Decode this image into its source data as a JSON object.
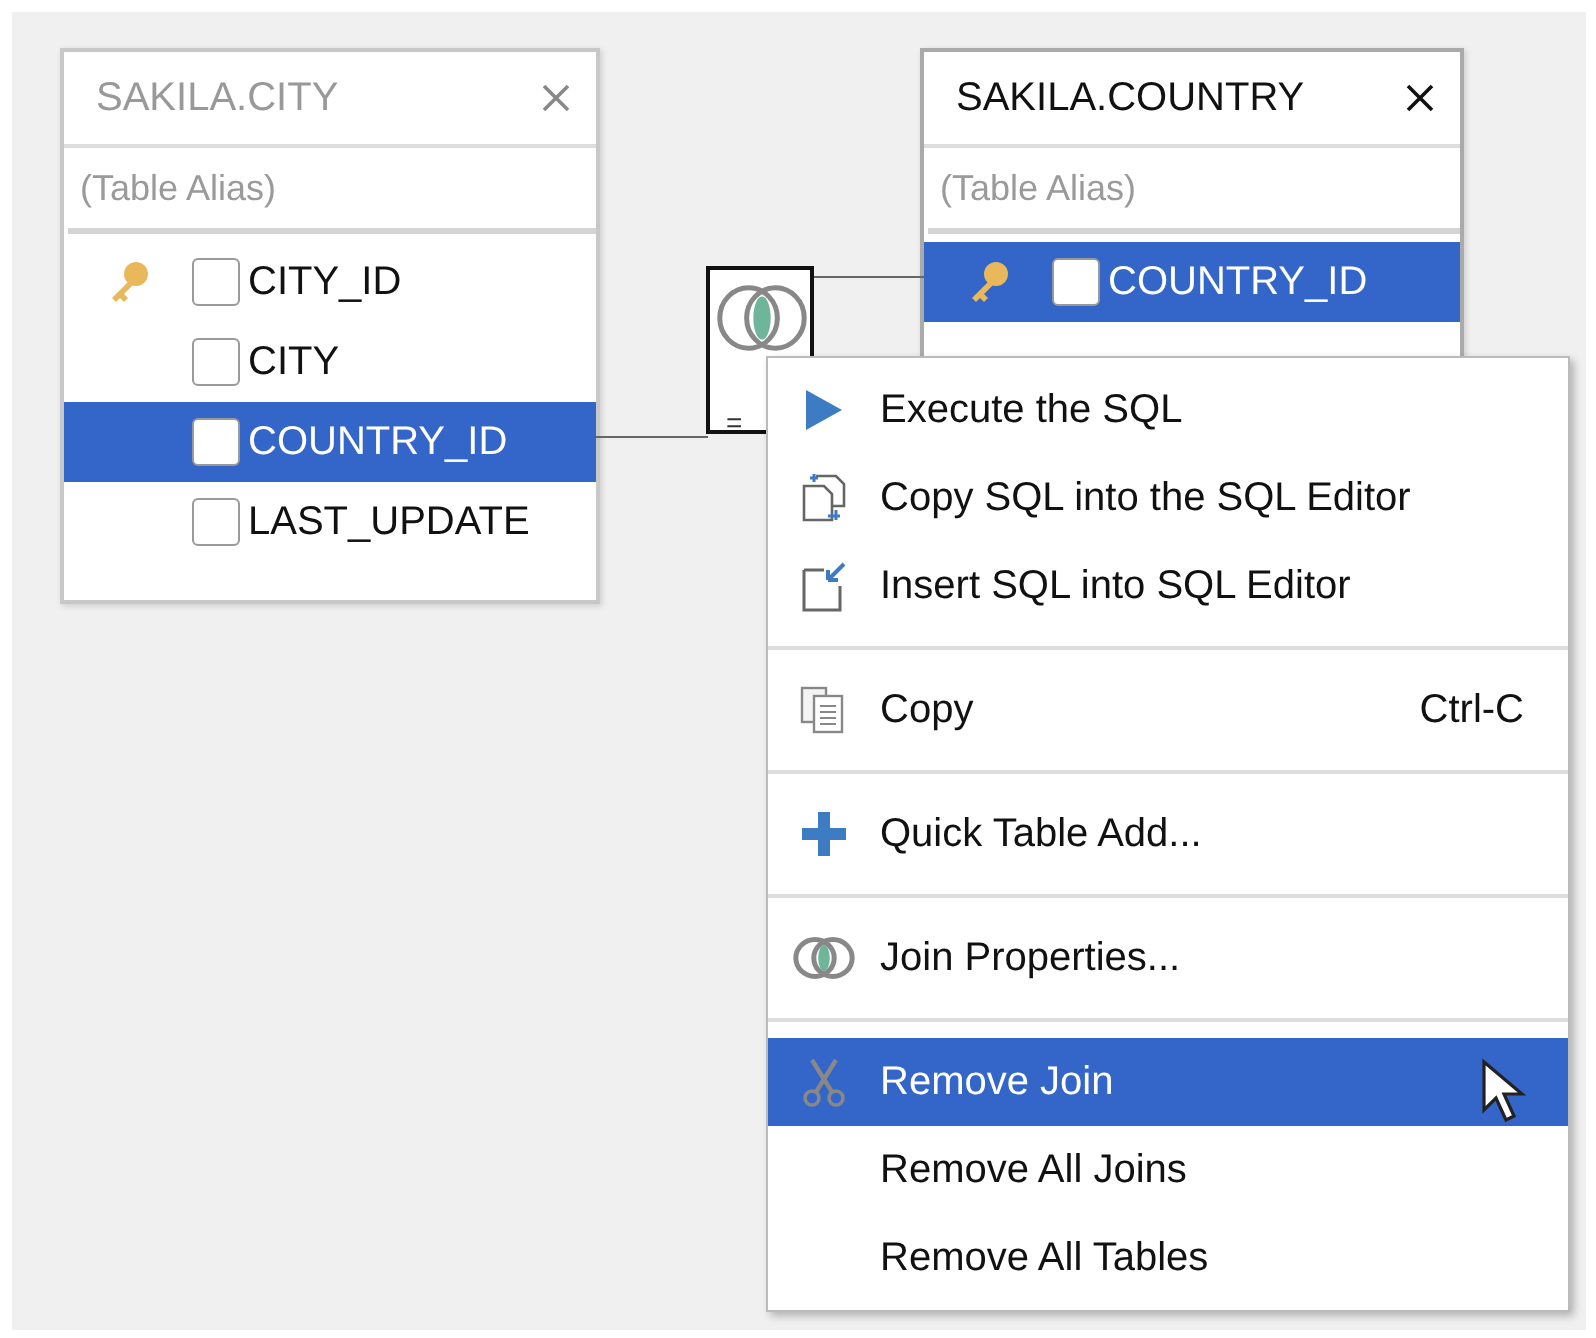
{
  "tables": [
    {
      "title": "SAKILA.CITY",
      "active": false,
      "alias_placeholder": "(Table Alias)",
      "columns": [
        {
          "name": "CITY_ID",
          "primary_key": true,
          "checked": false,
          "selected": false
        },
        {
          "name": "CITY",
          "primary_key": false,
          "checked": false,
          "selected": false
        },
        {
          "name": "COUNTRY_ID",
          "primary_key": false,
          "checked": false,
          "selected": true
        },
        {
          "name": "LAST_UPDATE",
          "primary_key": false,
          "checked": false,
          "selected": false
        }
      ]
    },
    {
      "title": "SAKILA.COUNTRY",
      "active": true,
      "alias_placeholder": "(Table Alias)",
      "columns": [
        {
          "name": "COUNTRY_ID",
          "primary_key": true,
          "checked": false,
          "selected": true
        }
      ]
    }
  ],
  "join": {
    "operator": "="
  },
  "context_menu": [
    {
      "kind": "item",
      "label": "Execute the SQL",
      "selected": false
    },
    {
      "kind": "item",
      "label": "Copy SQL into the SQL Editor",
      "selected": false
    },
    {
      "kind": "item",
      "label": "Insert SQL into SQL Editor",
      "selected": false
    },
    {
      "kind": "separator"
    },
    {
      "kind": "item",
      "label": "Copy",
      "shortcut": "Ctrl-C",
      "selected": false
    },
    {
      "kind": "separator"
    },
    {
      "kind": "item",
      "label": "Quick Table Add...",
      "selected": false
    },
    {
      "kind": "separator"
    },
    {
      "kind": "item",
      "label": "Join Properties...",
      "selected": false
    },
    {
      "kind": "separator"
    },
    {
      "kind": "item",
      "label": "Remove Join",
      "selected": true
    },
    {
      "kind": "item",
      "label": "Remove All Joins",
      "selected": false
    },
    {
      "kind": "item",
      "label": "Remove All Tables",
      "selected": false
    }
  ]
}
